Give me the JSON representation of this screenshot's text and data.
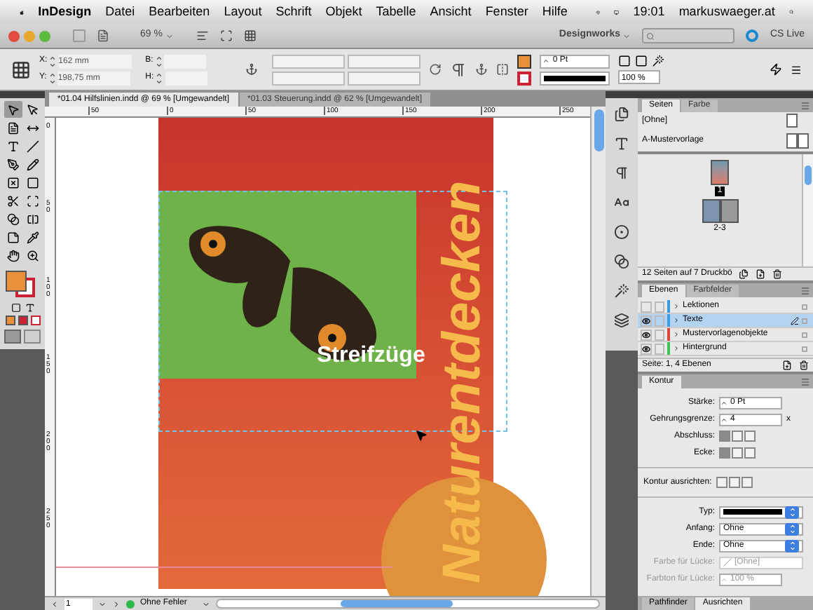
{
  "menubar": {
    "app": "InDesign",
    "menus": [
      "Datei",
      "Bearbeiten",
      "Layout",
      "Schrift",
      "Objekt",
      "Tabelle",
      "Ansicht",
      "Fenster",
      "Hilfe"
    ],
    "time": "19:01",
    "user": "markuswaeger.at"
  },
  "appbar": {
    "zoom": "69 %",
    "workspace": "Designworks",
    "cs_live": "CS Live"
  },
  "control_panel": {
    "fields": [
      {
        "label": "X:",
        "value": "162 mm"
      },
      {
        "label": "Y:",
        "value": "198,75 mm"
      },
      {
        "label": "B:"
      },
      {
        "label": "H:"
      }
    ],
    "stroke_weight": "0 Pt",
    "scale": "100 %"
  },
  "document_tabs": [
    {
      "title": "*01.04 Hilfslinien.indd @ 69 % [Umgewandelt]",
      "selected": true
    },
    {
      "title": "*01.03 Steuerung.indd @ 62 % [Umgewandelt]",
      "selected": false
    }
  ],
  "ruler": {
    "top_ticks": [
      "50",
      "0",
      "50",
      "100",
      "150",
      "200",
      "250"
    ],
    "left_ticks": [
      "0",
      "50",
      "100",
      "150",
      "200",
      "250"
    ]
  },
  "tools": [
    {
      "kind": "selection",
      "selected": true
    },
    {
      "kind": "direct",
      "selected": false
    },
    {
      "kind": "page",
      "selected": false
    },
    {
      "kind": "gap",
      "selected": false
    },
    {
      "kind": "type",
      "selected": false
    },
    {
      "kind": "line",
      "selected": false
    },
    {
      "kind": "pen",
      "selected": false
    },
    {
      "kind": "pencil",
      "selected": false
    },
    {
      "kind": "frame",
      "selected": false
    },
    {
      "kind": "rect",
      "selected": false
    },
    {
      "kind": "scissors",
      "selected": false
    },
    {
      "kind": "transform",
      "selected": false
    },
    {
      "kind": "gradient",
      "selected": false
    },
    {
      "kind": "feather",
      "selected": false
    },
    {
      "kind": "note",
      "selected": false
    },
    {
      "kind": "eyedropper",
      "selected": false
    },
    {
      "kind": "hand",
      "selected": false
    },
    {
      "kind": "zoom",
      "selected": false
    }
  ],
  "page": {
    "headline": "Streifzüge",
    "vertical_title": "Naturentdecken"
  },
  "status_bar": {
    "page": "1",
    "preflight": "Ohne Fehler"
  },
  "pages_panel": {
    "tabs": [
      {
        "label": "Seiten",
        "selected": true
      },
      {
        "label": "Farbe",
        "selected": false
      }
    ],
    "masters": [
      {
        "name": "[Ohne]",
        "kind": "single"
      },
      {
        "name": "A-Mustervorlage",
        "kind": "spread"
      }
    ],
    "pages": [
      {
        "label": "1",
        "kind": "single",
        "selected": true
      },
      {
        "label": "2-3",
        "kind": "spread",
        "selected": false
      }
    ],
    "summary": "12 Seiten auf 7 Druckbö"
  },
  "layers_panel": {
    "tabs": [
      {
        "label": "Ebenen",
        "selected": true
      },
      {
        "label": "Farbfelder",
        "selected": false
      }
    ],
    "layers": [
      {
        "name": "Lektionen",
        "visible": false,
        "color": "#3c9be0",
        "selected": false
      },
      {
        "name": "Texte",
        "visible": true,
        "color": "#3c9be0",
        "selected": true
      },
      {
        "name": "Mustervorlagenobjekte",
        "visible": true,
        "color": "#e0453c",
        "selected": false
      },
      {
        "name": "Hintergrund",
        "visible": true,
        "color": "#3cc45a",
        "selected": false
      }
    ],
    "summary": "Seite: 1, 4 Ebenen"
  },
  "stroke_panel": {
    "title": "Kontur",
    "rows": [
      {
        "kind": "stepper",
        "label": "Stärke:",
        "value": "0 Pt",
        "disabled": false
      },
      {
        "kind": "stepper",
        "label": "Gehrungsgrenze:",
        "value": "4",
        "suffix": "x",
        "disabled": false
      },
      {
        "kind": "buttons",
        "label": "Abschluss:",
        "options": [
          {
            "selected": true
          },
          {
            "selected": false
          },
          {
            "selected": false
          }
        ],
        "disabled": false
      },
      {
        "kind": "buttons",
        "label": "Ecke:",
        "options": [
          {
            "selected": true
          },
          {
            "selected": false
          },
          {
            "selected": false
          }
        ],
        "disabled": false
      },
      {
        "kind": "buttons",
        "label": "Kontur ausrichten:",
        "options": [
          {
            "selected": false
          },
          {
            "selected": false
          },
          {
            "selected": false
          }
        ],
        "disabled": false
      },
      {
        "kind": "line-select",
        "label": "Typ:",
        "disabled": false
      },
      {
        "kind": "select",
        "label": "Anfang:",
        "value": "Ohne",
        "disabled": false
      },
      {
        "kind": "select",
        "label": "Ende:",
        "value": "Ohne",
        "disabled": false
      },
      {
        "kind": "swatch-select",
        "label": "Farbe für Lücke:",
        "value": "[Ohne]",
        "disabled": true
      },
      {
        "kind": "stepper",
        "label": "Farbton für Lücke:",
        "value": "100 %",
        "disabled": true
      }
    ]
  },
  "bottom_tabs": [
    {
      "label": "Pathfinder",
      "selected": false
    },
    {
      "label": "Ausrichten",
      "selected": true
    }
  ]
}
